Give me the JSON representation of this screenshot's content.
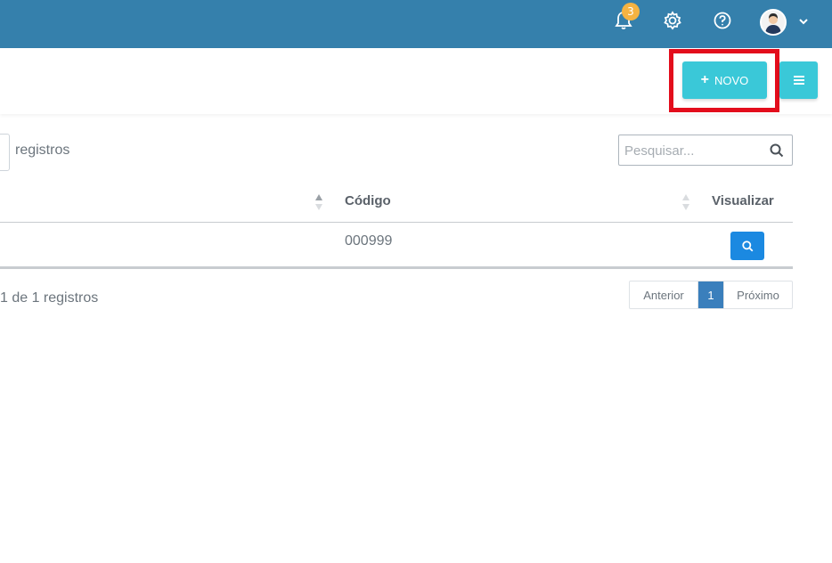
{
  "topbar": {
    "notification_count": "3",
    "icons": [
      "bell-icon",
      "gear-icon",
      "help-icon",
      "avatar",
      "chevron-down-icon"
    ],
    "bg_color": "#3580ac"
  },
  "toolbar": {
    "new_label": "NOVO",
    "new_icon": "plus-icon",
    "menu_icon": "menu-icon",
    "button_color": "#3ac8d8",
    "highlight_color": "#e30d1c"
  },
  "table": {
    "length_suffix": "registros",
    "search_placeholder": "Pesquisar...",
    "columns": [
      "Código",
      "Visualizar"
    ],
    "rows": [
      {
        "codigo": "000999"
      }
    ],
    "info": "1 de 1 registros"
  },
  "pagination": {
    "prev_label": "Anterior",
    "current_page": "1",
    "next_label": "Próximo"
  }
}
